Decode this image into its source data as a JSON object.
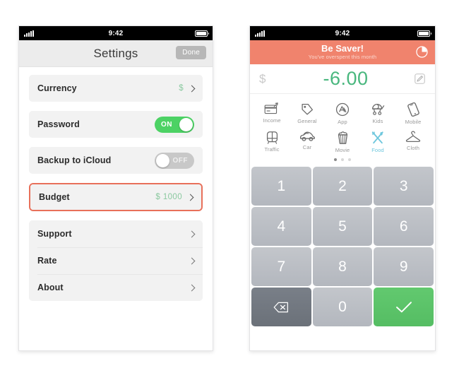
{
  "phone_left": {
    "status_bar": {
      "time": "9:42",
      "signal_icon": "signal-bars-icon",
      "battery_icon": "battery-icon"
    },
    "nav": {
      "title": "Settings",
      "done_label": "Done"
    },
    "groups": [
      {
        "highlighted": false,
        "rows": [
          {
            "label": "Currency",
            "value": "$",
            "accessory": "chevron",
            "name": "currency"
          }
        ]
      },
      {
        "highlighted": false,
        "rows": [
          {
            "label": "Password",
            "value": "ON",
            "accessory": "toggle-on",
            "name": "password"
          }
        ]
      },
      {
        "highlighted": false,
        "rows": [
          {
            "label": "Backup to iCloud",
            "value": "OFF",
            "accessory": "toggle-off",
            "name": "backup-to-icloud"
          }
        ]
      },
      {
        "highlighted": true,
        "rows": [
          {
            "label": "Budget",
            "value": "$ 1000",
            "accessory": "chevron",
            "name": "budget"
          }
        ]
      },
      {
        "highlighted": false,
        "rows": [
          {
            "label": "Support",
            "value": "",
            "accessory": "chevron",
            "name": "support"
          },
          {
            "label": "Rate",
            "value": "",
            "accessory": "chevron",
            "name": "rate"
          },
          {
            "label": "About",
            "value": "",
            "accessory": "chevron",
            "name": "about"
          }
        ]
      }
    ]
  },
  "phone_right": {
    "status_bar": {
      "time": "9:42",
      "signal_icon": "signal-bars-icon",
      "battery_icon": "battery-icon"
    },
    "banner": {
      "title": "Be Saver!",
      "subtitle": "You've overspent this month",
      "icon": "pie-chart-icon",
      "color": "#f0836d"
    },
    "amount": {
      "currency_symbol": "$",
      "value": "-6.00",
      "color": "#49b77e",
      "edit_icon": "pencil-edit-icon"
    },
    "categories": [
      {
        "label": "Income",
        "icon": "credit-card-icon",
        "active": false
      },
      {
        "label": "General",
        "icon": "tag-icon",
        "active": false
      },
      {
        "label": "App",
        "icon": "app-store-icon",
        "active": false
      },
      {
        "label": "Kids",
        "icon": "stroller-icon",
        "active": false
      },
      {
        "label": "Mobile",
        "icon": "smartphone-icon",
        "active": false
      },
      {
        "label": "Traffic",
        "icon": "train-icon",
        "active": false
      },
      {
        "label": "Car",
        "icon": "car-icon",
        "active": false
      },
      {
        "label": "Movie",
        "icon": "popcorn-icon",
        "active": false
      },
      {
        "label": "Food",
        "icon": "fork-knife-icon",
        "active": true
      },
      {
        "label": "Cloth",
        "icon": "hanger-icon",
        "active": false
      }
    ],
    "page_dots": {
      "count": 3,
      "active_index": 0
    },
    "keypad": [
      {
        "label": "1",
        "name": "key-1",
        "style": "num"
      },
      {
        "label": "2",
        "name": "key-2",
        "style": "num"
      },
      {
        "label": "3",
        "name": "key-3",
        "style": "num"
      },
      {
        "label": "4",
        "name": "key-4",
        "style": "num"
      },
      {
        "label": "5",
        "name": "key-5",
        "style": "num"
      },
      {
        "label": "6",
        "name": "key-6",
        "style": "num"
      },
      {
        "label": "7",
        "name": "key-7",
        "style": "num"
      },
      {
        "label": "8",
        "name": "key-8",
        "style": "num"
      },
      {
        "label": "9",
        "name": "key-9",
        "style": "num"
      },
      {
        "label": "",
        "name": "key-backspace",
        "style": "back",
        "icon": "backspace-icon"
      },
      {
        "label": "0",
        "name": "key-0",
        "style": "num"
      },
      {
        "label": "",
        "name": "key-confirm",
        "style": "ok",
        "icon": "checkmark-icon"
      }
    ]
  },
  "colors": {
    "accent_coral": "#f0836d",
    "accent_green": "#49b77e",
    "toggle_on": "#4cd264",
    "toggle_off": "#c8c8c8",
    "highlight_border": "#e8705a",
    "key_green": "#55bd63",
    "active_category": "#6ec7dd"
  }
}
